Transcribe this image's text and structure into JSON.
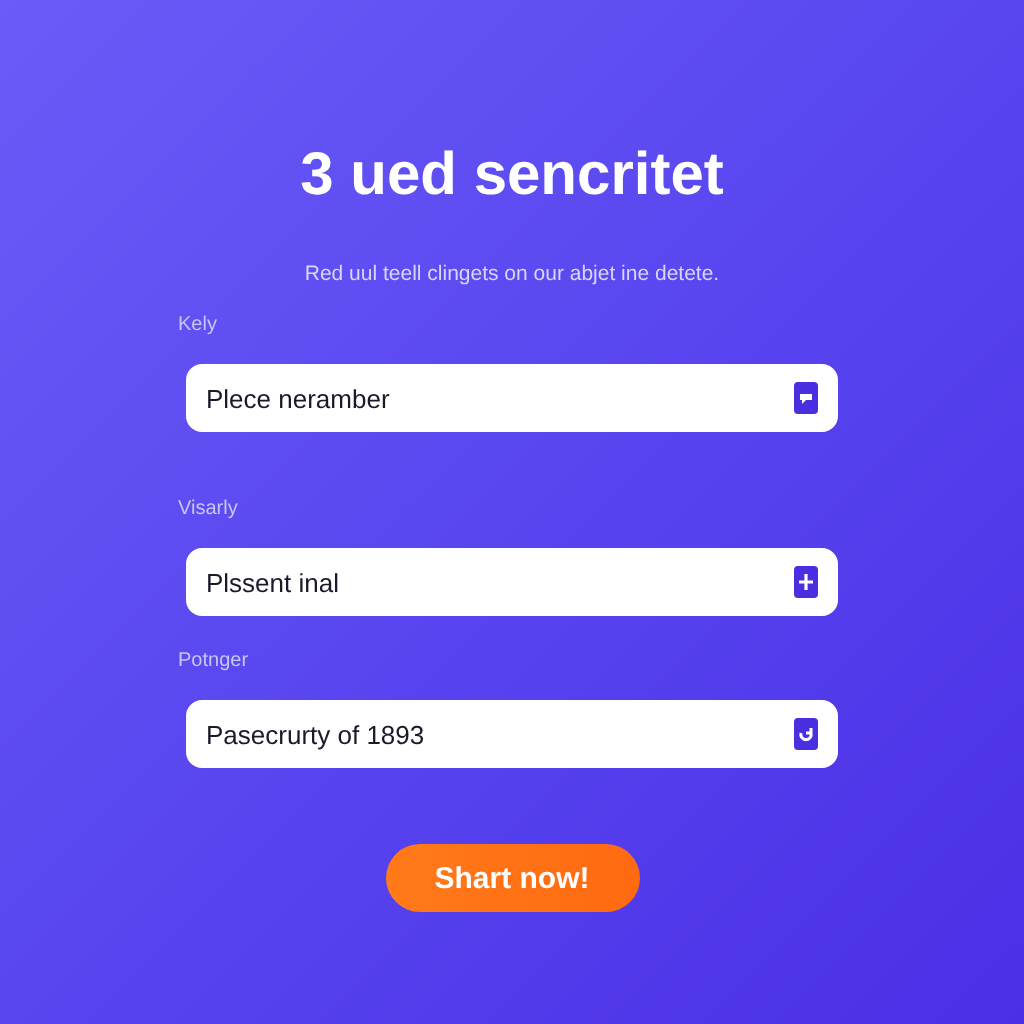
{
  "title": "3 ued sencritet",
  "subtitle": "Red uul teell clingets on our abjet ine detete.",
  "fields": [
    {
      "label": "Kely",
      "value": "Plece neramber",
      "kind": "chat"
    },
    {
      "label": "Visarly",
      "value": "Plssent inal",
      "kind": "plus"
    },
    {
      "label": "Potnger",
      "value": "Pasecrurty of 1893",
      "kind": "refresh"
    }
  ],
  "button": "Shart now!"
}
